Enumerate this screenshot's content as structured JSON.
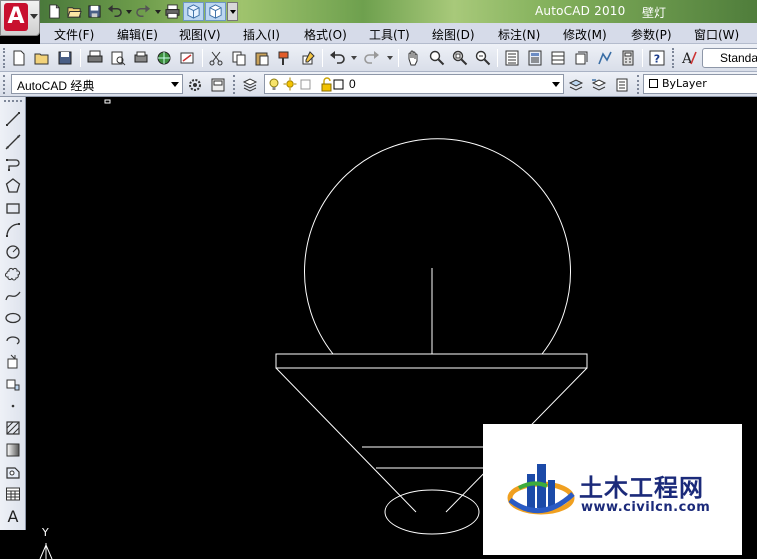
{
  "window": {
    "app_title": "AutoCAD 2010",
    "doc_title": "壁灯"
  },
  "menu": {
    "items": [
      {
        "label": "文件(F)"
      },
      {
        "label": "编辑(E)"
      },
      {
        "label": "视图(V)"
      },
      {
        "label": "插入(I)"
      },
      {
        "label": "格式(O)"
      },
      {
        "label": "工具(T)"
      },
      {
        "label": "绘图(D)"
      },
      {
        "label": "标注(N)"
      },
      {
        "label": "修改(M)"
      },
      {
        "label": "参数(P)"
      },
      {
        "label": "窗口(W)"
      }
    ]
  },
  "toolbar": {
    "text_style_value": "Standard"
  },
  "workspace": {
    "current": "AutoCAD 经典"
  },
  "layer": {
    "current": "0",
    "color_value": "ByLayer"
  },
  "draw_toolbar": {
    "text_tool": "A"
  },
  "canvas": {
    "ucs_axis_label": "Y",
    "background": "#000000",
    "stroke": "#ffffff"
  },
  "watermark": {
    "name": "土木工程网",
    "url": "www.civilcn.com"
  },
  "colors": {
    "menubar": "#d6dbe9",
    "logo_red": "#c8102e",
    "watermark_text": "#1b2a7a"
  }
}
